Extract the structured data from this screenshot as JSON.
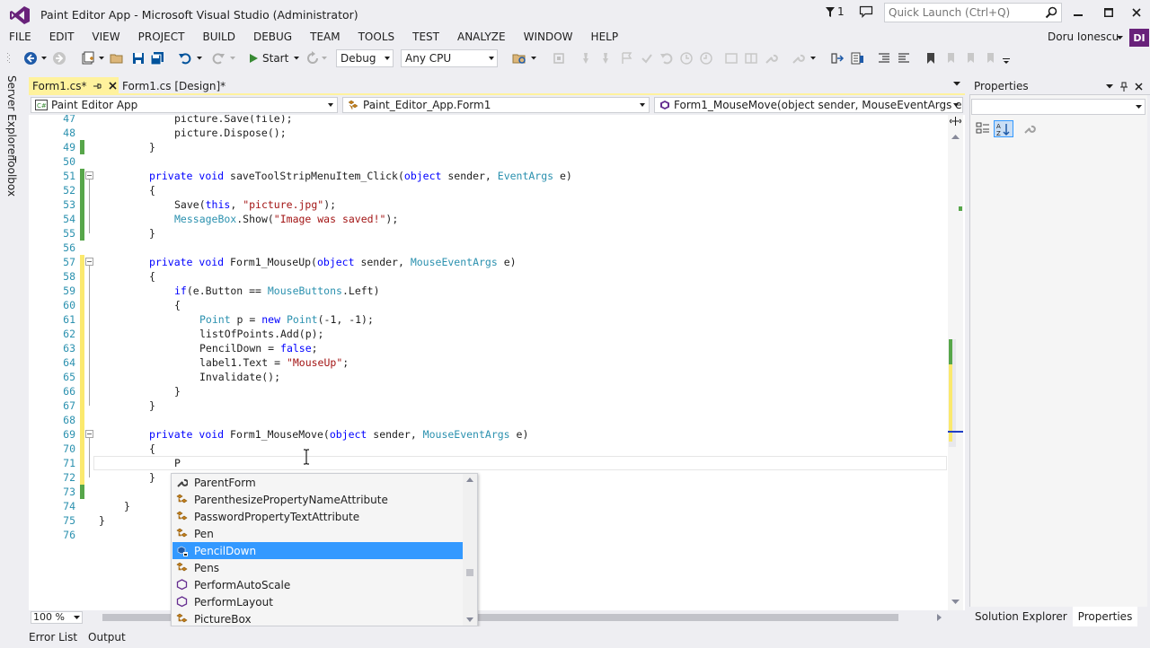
{
  "window": {
    "title": "Paint Editor App - Microsoft Visual Studio (Administrator)",
    "notification_count": "1",
    "quick_launch_placeholder": "Quick Launch (Ctrl+Q)",
    "user_name": "Doru Ionescu",
    "user_initials": "DI",
    "accent": "#68217a"
  },
  "menu": [
    "FILE",
    "EDIT",
    "VIEW",
    "PROJECT",
    "BUILD",
    "DEBUG",
    "TEAM",
    "TOOLS",
    "TEST",
    "ANALYZE",
    "WINDOW",
    "HELP"
  ],
  "toolbar": {
    "start_label": "Start",
    "configuration": "Debug",
    "platform": "Any CPU"
  },
  "tabs": [
    {
      "label": "Form1.cs*",
      "active": true
    },
    {
      "label": "Form1.cs [Design]*",
      "active": false
    }
  ],
  "side_tabs": [
    "Server Explorer",
    "Toolbox"
  ],
  "navbar": {
    "project": "Paint Editor App",
    "class": "Paint_Editor_App.Form1",
    "member": "Form1_MouseMove(object sender, MouseEventArgs e)"
  },
  "code_lines": [
    {
      "n": "47",
      "text": "picture.Save(file);"
    },
    {
      "n": "48",
      "text": "picture.Dispose();"
    },
    {
      "n": "49",
      "text": "}"
    },
    {
      "n": "50",
      "text": ""
    },
    {
      "n": "51",
      "text": "private void saveToolStripMenuItem_Click(object sender, EventArgs e)"
    },
    {
      "n": "52",
      "text": "{"
    },
    {
      "n": "53",
      "text": "Save(this, \"picture.jpg\");"
    },
    {
      "n": "54",
      "text": "MessageBox.Show(\"Image was saved!\");"
    },
    {
      "n": "55",
      "text": "}"
    },
    {
      "n": "56",
      "text": ""
    },
    {
      "n": "57",
      "text": "private void Form1_MouseUp(object sender, MouseEventArgs e)"
    },
    {
      "n": "58",
      "text": "{"
    },
    {
      "n": "59",
      "text": "if(e.Button == MouseButtons.Left)"
    },
    {
      "n": "60",
      "text": "{"
    },
    {
      "n": "61",
      "text": "Point p = new Point(-1, -1);"
    },
    {
      "n": "62",
      "text": "listOfPoints.Add(p);"
    },
    {
      "n": "63",
      "text": "PencilDown = false;"
    },
    {
      "n": "64",
      "text": "label1.Text = \"MouseUp\";"
    },
    {
      "n": "65",
      "text": "Invalidate();"
    },
    {
      "n": "66",
      "text": "}"
    },
    {
      "n": "67",
      "text": "}"
    },
    {
      "n": "68",
      "text": ""
    },
    {
      "n": "69",
      "text": "private void Form1_MouseMove(object sender, MouseEventArgs e)"
    },
    {
      "n": "70",
      "text": "{"
    },
    {
      "n": "71",
      "text": "P"
    },
    {
      "n": "72",
      "text": "}"
    },
    {
      "n": "73",
      "text": ""
    },
    {
      "n": "74",
      "text": "}"
    },
    {
      "n": "75",
      "text": "}"
    },
    {
      "n": "76",
      "text": ""
    }
  ],
  "completion": {
    "items": [
      {
        "label": "ParentForm",
        "icon": "wrench-property-icon"
      },
      {
        "label": "ParenthesizePropertyNameAttribute",
        "icon": "class-icon"
      },
      {
        "label": "PasswordPropertyTextAttribute",
        "icon": "class-icon"
      },
      {
        "label": "Pen",
        "icon": "class-icon"
      },
      {
        "label": "PencilDown",
        "icon": "field-icon",
        "selected": true
      },
      {
        "label": "Pens",
        "icon": "class-icon"
      },
      {
        "label": "PerformAutoScale",
        "icon": "method-icon"
      },
      {
        "label": "PerformLayout",
        "icon": "method-icon"
      },
      {
        "label": "PictureBox",
        "icon": "class-icon"
      }
    ]
  },
  "editor": {
    "zoom": "100 %"
  },
  "properties": {
    "title": "Properties",
    "bottom_tabs": [
      "Solution Explorer",
      "Properties"
    ]
  },
  "status": {
    "tabs": [
      "Error List",
      "Output"
    ]
  }
}
